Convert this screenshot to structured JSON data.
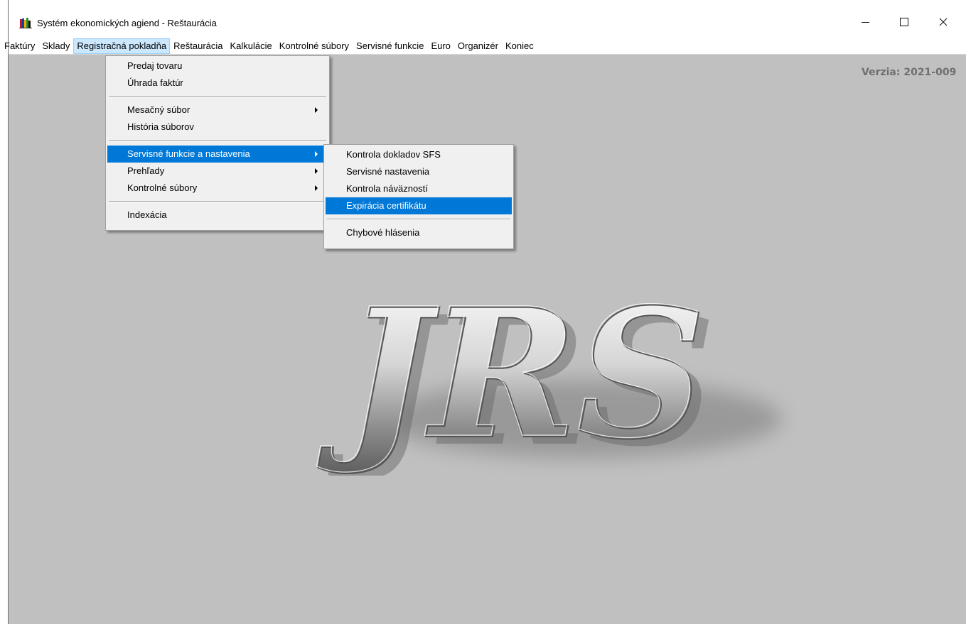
{
  "window": {
    "title": "Systém ekonomických agiend - Reštaurácia",
    "app_icon": "books-app-icon"
  },
  "menubar": {
    "items": [
      {
        "label": "Faktúry"
      },
      {
        "label": "Sklady"
      },
      {
        "label": "Registračná pokladňa",
        "open": true
      },
      {
        "label": "Reštaurácia"
      },
      {
        "label": "Kalkulácie"
      },
      {
        "label": "Kontrolné súbory"
      },
      {
        "label": "Servisné funkcie"
      },
      {
        "label": "Euro"
      },
      {
        "label": "Organizér"
      },
      {
        "label": "Koniec"
      }
    ]
  },
  "client": {
    "version": "Verzia: 2021-009",
    "logo_text": "JRS",
    "background_color": "#c0c0c0"
  },
  "dropdown": {
    "items": [
      {
        "label": "Predaj tovaru"
      },
      {
        "label": "Úhrada faktúr"
      },
      {
        "label": "Mesačný súbor",
        "submenu": true
      },
      {
        "label": "História súborov"
      },
      {
        "label": "Servisné funkcie a nastavenia",
        "submenu": true,
        "selected": true
      },
      {
        "label": "Prehľady",
        "submenu": true
      },
      {
        "label": "Kontrolné súbory",
        "submenu": true
      },
      {
        "label": "Indexácia"
      }
    ]
  },
  "submenu": {
    "items": [
      {
        "label": "Kontrola dokladov SFS"
      },
      {
        "label": "Servisné nastavenia"
      },
      {
        "label": "Kontrola náväzností"
      },
      {
        "label": "Expirácia certifikátu",
        "selected": true
      },
      {
        "label": "Chybové hlásenia"
      }
    ]
  },
  "colors": {
    "selection": "#0078d7",
    "menu_open_highlight": "#cce8ff",
    "menu_background": "#f0f0f0"
  }
}
